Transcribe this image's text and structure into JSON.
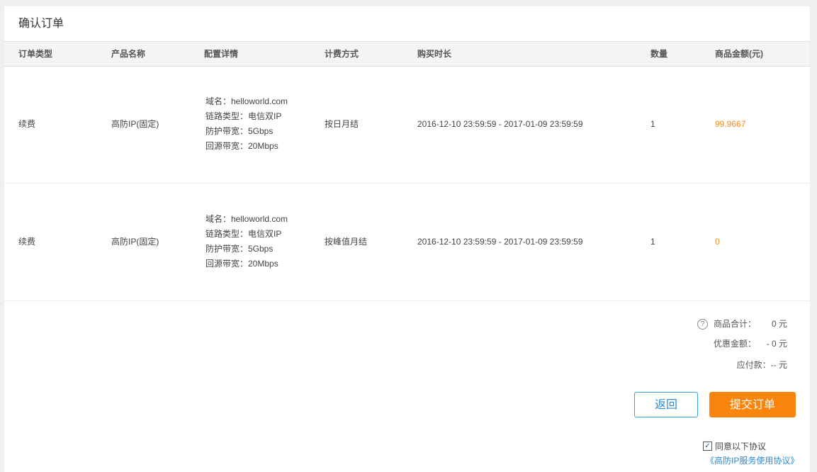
{
  "title": "确认订单",
  "columns": [
    "订单类型",
    "产品名称",
    "配置详情",
    "计费方式",
    "购买时长",
    "数量",
    "商品金额(元)"
  ],
  "rows": [
    {
      "order_type": "续费",
      "product": "高防IP(固定)",
      "config": [
        "域名：helloworld.com",
        "链路类型：电信双IP",
        "防护带宽：5Gbps",
        "回源带宽：20Mbps"
      ],
      "billing": "按日月结",
      "duration": "2016-12-10 23:59:59 - 2017-01-09 23:59:59",
      "quantity": "1",
      "amount": "99.9667"
    },
    {
      "order_type": "续费",
      "product": "高防IP(固定)",
      "config": [
        "域名：helloworld.com",
        "链路类型：电信双IP",
        "防护带宽：5Gbps",
        "回源带宽：20Mbps"
      ],
      "billing": "按峰值月结",
      "duration": "2016-12-10 23:59:59 - 2017-01-09 23:59:59",
      "quantity": "1",
      "amount": "0"
    }
  ],
  "summary": {
    "help_icon": "?",
    "subtotal_label": "商品合计：",
    "subtotal_value": "0 元",
    "discount_label": "优惠金额：",
    "discount_value": "- 0 元",
    "payable_label": "应付款：",
    "payable_value": "-- 元"
  },
  "buttons": {
    "back": "返回",
    "submit": "提交订单"
  },
  "agreement": {
    "checked": true,
    "label": "同意以下协议",
    "link": "《高防IP服务使用协议》"
  },
  "colors": {
    "accent_orange": "#f9850d",
    "link_blue": "#2a8ad6",
    "price": "#f28c1d"
  }
}
